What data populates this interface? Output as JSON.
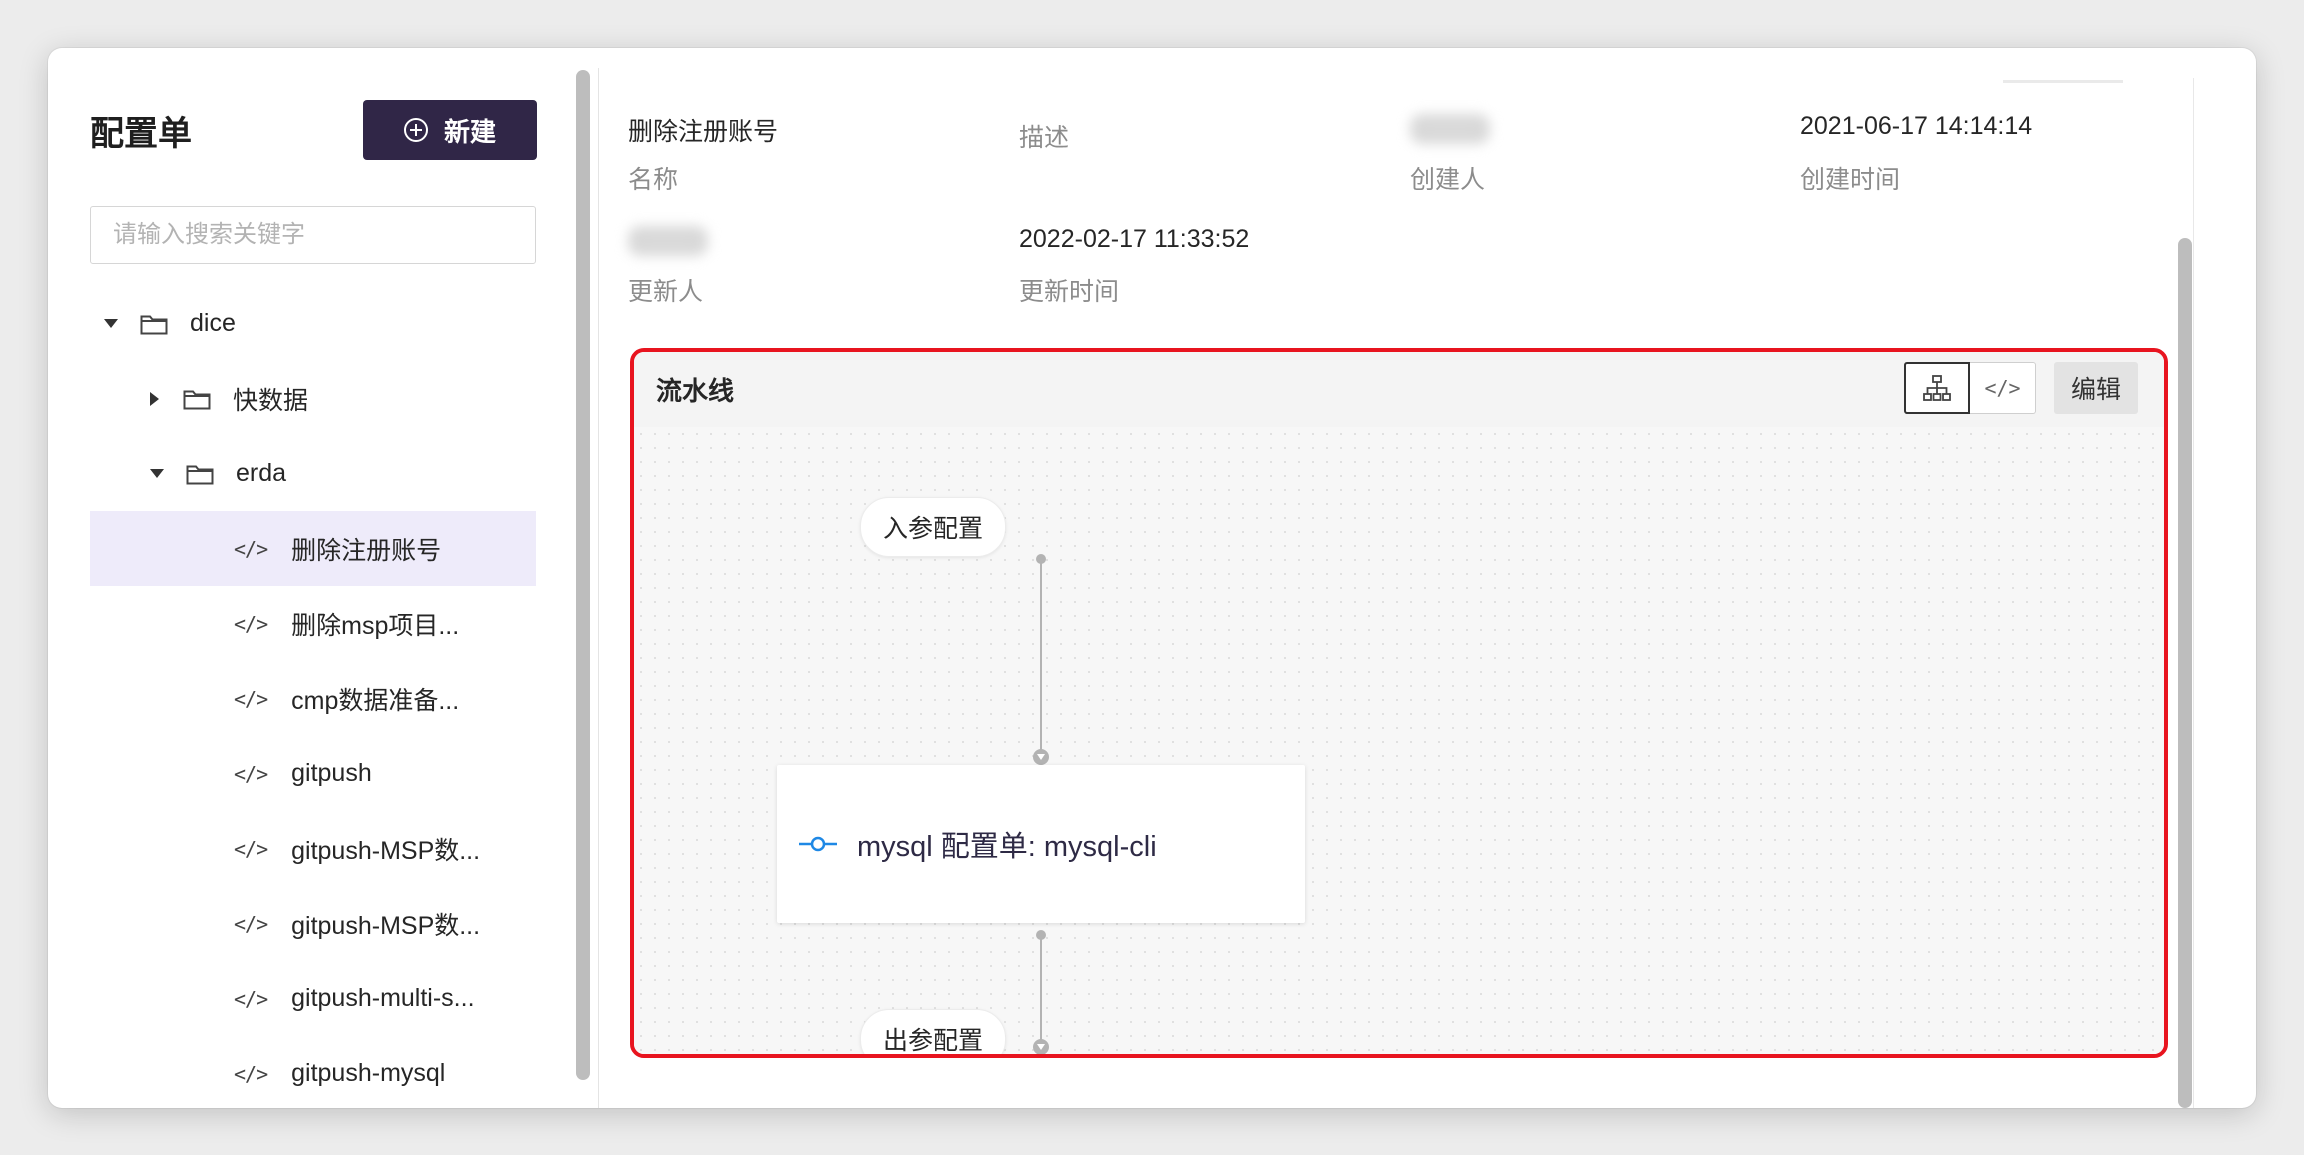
{
  "sidebar": {
    "title": "配置单",
    "new_button": "新建",
    "search_placeholder": "请输入搜索关键字",
    "tree": [
      {
        "label": "dice",
        "type": "folder",
        "level": 0,
        "expanded": true
      },
      {
        "label": "快数据",
        "type": "folder",
        "level": 1,
        "expanded": false
      },
      {
        "label": "erda",
        "type": "folder",
        "level": 1,
        "expanded": true
      },
      {
        "label": "删除注册账号",
        "type": "file",
        "level": 2,
        "selected": true
      },
      {
        "label": "删除msp项目...",
        "type": "file",
        "level": 2
      },
      {
        "label": "cmp数据准备...",
        "type": "file",
        "level": 2
      },
      {
        "label": "gitpush",
        "type": "file",
        "level": 2
      },
      {
        "label": "gitpush-MSP数...",
        "type": "file",
        "level": 2
      },
      {
        "label": "gitpush-MSP数...",
        "type": "file",
        "level": 2
      },
      {
        "label": "gitpush-multi-s...",
        "type": "file",
        "level": 2
      },
      {
        "label": "gitpush-mysql",
        "type": "file",
        "level": 2
      }
    ]
  },
  "info": {
    "name_value": "删除注册账号",
    "name_label": "名称",
    "desc_label": "描述",
    "creator_label": "创建人",
    "created_time_value": "2021-06-17 14:14:14",
    "created_time_label": "创建时间",
    "updater_label": "更新人",
    "updated_time_value": "2022-02-17 11:33:52",
    "updated_time_label": "更新时间"
  },
  "pipeline": {
    "title": "流水线",
    "view_graph_icon": "sitemap-icon",
    "view_code_icon": "code-icon",
    "edit_button": "编辑",
    "input_node": "入参配置",
    "task_node": "mysql 配置单: mysql-cli",
    "output_node": "出参配置",
    "highlight_color": "#e8141f"
  },
  "colors": {
    "primary": "#302647",
    "selected_bg": "#eeebfa",
    "commit_icon": "#1e88e5"
  }
}
